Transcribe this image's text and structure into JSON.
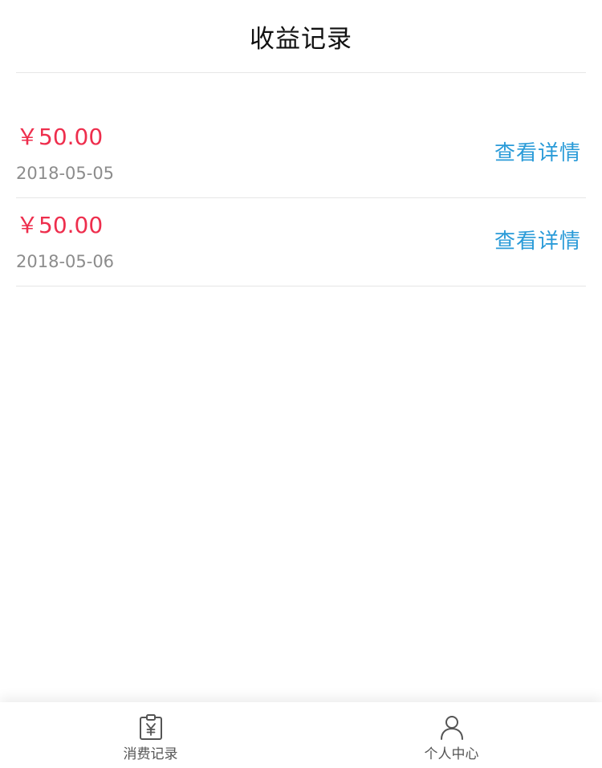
{
  "header": {
    "title": "收益记录"
  },
  "records": [
    {
      "amount": "￥50.00",
      "date": "2018-05-05",
      "action": "查看详情"
    },
    {
      "amount": "￥50.00",
      "date": "2018-05-06",
      "action": "查看详情"
    }
  ],
  "tabbar": {
    "items": [
      {
        "label": "消费记录",
        "icon": "receipt-yen-icon"
      },
      {
        "label": "个人中心",
        "icon": "user-icon"
      }
    ]
  },
  "colors": {
    "amount": "#ee2e4d",
    "link": "#2a9bd8",
    "date": "#8c8c8c",
    "divider": "#e6e6e6"
  }
}
